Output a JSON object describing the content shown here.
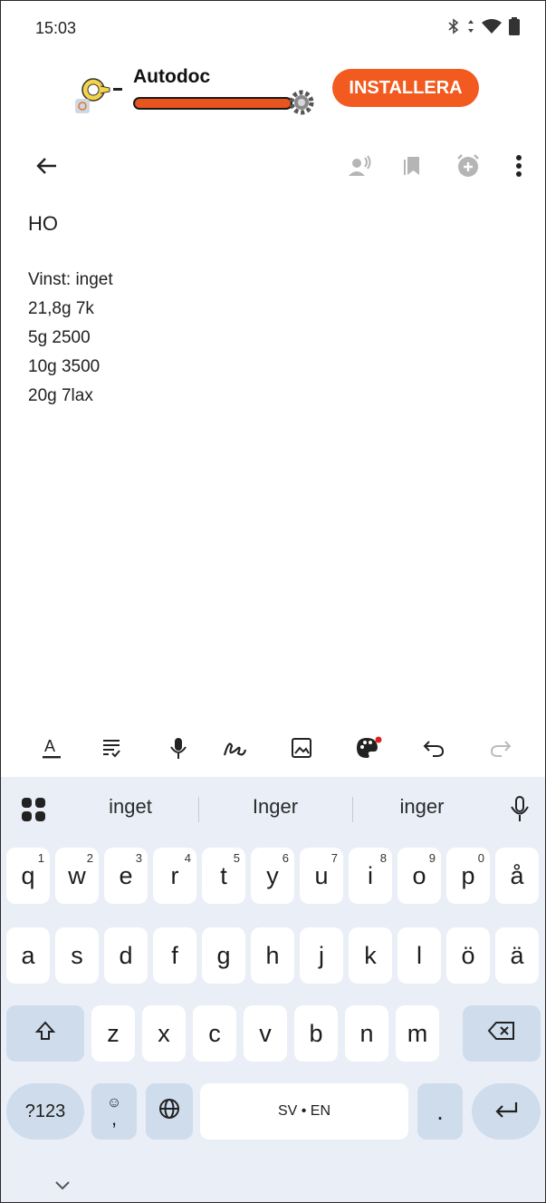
{
  "status_bar": {
    "time": "15:03"
  },
  "ad": {
    "app_name": "Autodoc",
    "install_label": "INSTALLERA"
  },
  "toolbar": {
    "icons": [
      "back-arrow-icon",
      "speaker-share-icon",
      "bookmark-icon",
      "add-alarm-icon",
      "more-vert-icon"
    ]
  },
  "note": {
    "title": "HO",
    "lines": [
      "Vinst: inget",
      "21,8g 7k",
      "5g 2500",
      "10g 3500",
      "20g 7lax"
    ]
  },
  "editor_tools": [
    "text-format-icon",
    "checklist-icon",
    "mic-icon",
    "draw-icon",
    "image-icon",
    "palette-icon",
    "undo-icon",
    "redo-icon"
  ],
  "keyboard": {
    "suggestions": [
      "inget",
      "Inger",
      "inger"
    ],
    "row1": [
      {
        "k": "q",
        "h": "1"
      },
      {
        "k": "w",
        "h": "2"
      },
      {
        "k": "e",
        "h": "3"
      },
      {
        "k": "r",
        "h": "4"
      },
      {
        "k": "t",
        "h": "5"
      },
      {
        "k": "y",
        "h": "6"
      },
      {
        "k": "u",
        "h": "7"
      },
      {
        "k": "i",
        "h": "8"
      },
      {
        "k": "o",
        "h": "9"
      },
      {
        "k": "p",
        "h": "0"
      },
      {
        "k": "å",
        "h": ""
      }
    ],
    "row2": [
      "a",
      "s",
      "d",
      "f",
      "g",
      "h",
      "j",
      "k",
      "l",
      "ö",
      "ä"
    ],
    "row3": [
      "z",
      "x",
      "c",
      "v",
      "b",
      "n",
      "m"
    ],
    "numbers_label": "?123",
    "comma_label": ",",
    "space_label": "SV • EN",
    "period_label": "."
  },
  "colors": {
    "accent": "#f25a1f",
    "keyboard_bg": "#eaeff7",
    "function_key": "#cfdcec"
  }
}
